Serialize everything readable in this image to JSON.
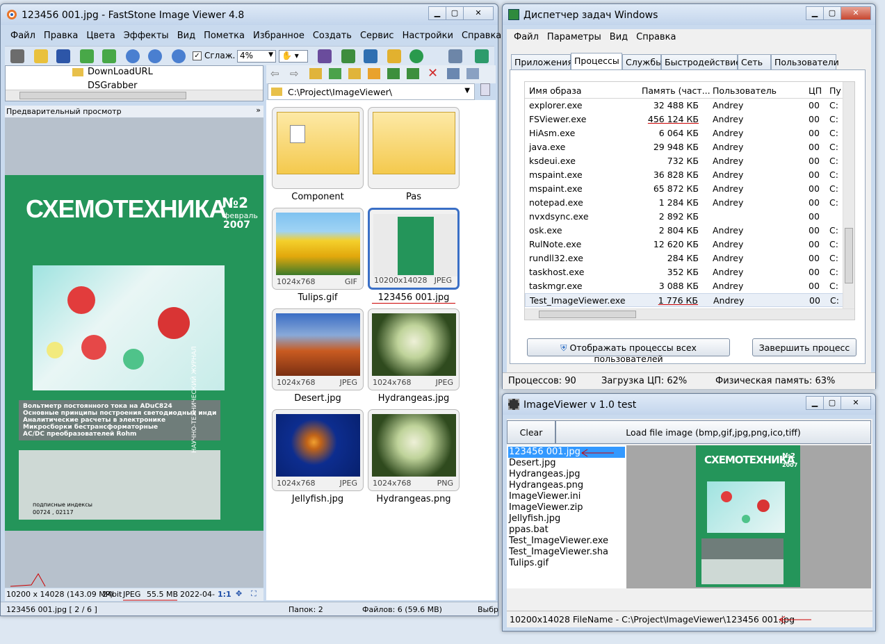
{
  "fs": {
    "title": "123456 001.jpg  -  FastStone Image Viewer 4.8",
    "menu": [
      "Файл",
      "Правка",
      "Цвета",
      "Эффекты",
      "Вид",
      "Пометка",
      "Избранное",
      "Создать",
      "Сервис",
      "Настройки",
      "Справка"
    ],
    "smooth_label": "Сглаж.",
    "zoom_value": "4%",
    "tree_items": [
      "DownLoadURL",
      "DSGrabber"
    ],
    "preview_label": "Предварительный просмотр",
    "path": "C:\\Project\\ImageViewer\\",
    "magazine": {
      "title": "СХЕМОТЕХНИКА",
      "issue": "№2",
      "month": "февраль",
      "year": "2007",
      "lines": [
        "Вольтметр постоянного тока на ADuC824",
        "Основные принципы построения светодиодных индикаторных панелей",
        "Аналитические расчеты в электронике",
        "Микросборки бестрансформаторные",
        "AC/DC преобразователей Rohm"
      ],
      "side_text": "НАУЧНО-ТЕХНИЧЕСКИЙ ЖУРНАЛ",
      "index_text": "подписные индексы",
      "index_num": "00724 , 02117"
    },
    "thumbs": [
      {
        "name": "Component",
        "kind": "folder"
      },
      {
        "name": "Pas",
        "kind": "folder"
      },
      {
        "name": "Tulips.gif",
        "dim": "1024x768",
        "fmt": "GIF"
      },
      {
        "name": "123456 001.jpg",
        "dim": "10200x14028",
        "fmt": "JPEG"
      },
      {
        "name": "Desert.jpg",
        "dim": "1024x768",
        "fmt": "JPEG"
      },
      {
        "name": "Hydrangeas.jpg",
        "dim": "1024x768",
        "fmt": "JPEG"
      },
      {
        "name": "Jellyfish.jpg",
        "dim": "1024x768",
        "fmt": "JPEG"
      },
      {
        "name": "Hydrangeas.png",
        "dim": "1024x768",
        "fmt": "PNG"
      }
    ],
    "info_bar": {
      "size": "10200 x 14028 (143.09 MP)",
      "bits": "24bit",
      "format": "JPEG",
      "filesize": "55.5 MB",
      "date": "2022-04-2",
      "ratio": "1:1"
    },
    "status": {
      "file": "123456 001.jpg [ 2 / 6 ]",
      "folders": "Папок: 2",
      "files": "Файлов: 6 (59.6 MB)",
      "sel": "Выбр"
    }
  },
  "tm": {
    "title": "Диспетчер задач Windows",
    "menu": [
      "Файл",
      "Параметры",
      "Вид",
      "Справка"
    ],
    "tabs": [
      "Приложения",
      "Процессы",
      "Службы",
      "Быстродействие",
      "Сеть",
      "Пользователи"
    ],
    "columns": [
      "Имя образа",
      "Память (част...",
      "Пользователь",
      "ЦП",
      "Пу"
    ],
    "rows": [
      [
        "explorer.exe",
        "32 488 КБ",
        "Andrey",
        "00",
        "C:"
      ],
      [
        "FSViewer.exe",
        "456 124 КБ",
        "Andrey",
        "00",
        "C:"
      ],
      [
        "HiAsm.exe",
        "6 064 КБ",
        "Andrey",
        "00",
        "C:"
      ],
      [
        "java.exe",
        "29 948 КБ",
        "Andrey",
        "00",
        "C:"
      ],
      [
        "ksdeui.exe",
        "732 КБ",
        "Andrey",
        "00",
        "C:"
      ],
      [
        "mspaint.exe",
        "36 828 КБ",
        "Andrey",
        "00",
        "C:"
      ],
      [
        "mspaint.exe",
        "65 872 КБ",
        "Andrey",
        "00",
        "C:"
      ],
      [
        "notepad.exe",
        "1 284 КБ",
        "Andrey",
        "00",
        "C:"
      ],
      [
        "nvxdsync.exe",
        "2 892 КБ",
        "",
        "00",
        ""
      ],
      [
        "osk.exe",
        "2 804 КБ",
        "Andrey",
        "00",
        "C:"
      ],
      [
        "RulNote.exe",
        "12 620 КБ",
        "Andrey",
        "00",
        "C:"
      ],
      [
        "rundll32.exe",
        "284 КБ",
        "Andrey",
        "00",
        "C:"
      ],
      [
        "taskhost.exe",
        "352 КБ",
        "Andrey",
        "00",
        "C:"
      ],
      [
        "taskmgr.exe",
        "3 088 КБ",
        "Andrey",
        "00",
        "C:"
      ],
      [
        "Test_ImageViewer.exe",
        "1 776 КБ",
        "Andrey",
        "00",
        "C:"
      ]
    ],
    "show_all_btn": "Отображать процессы всех пользователей",
    "end_btn": "Завершить процесс",
    "status": {
      "procs": "Процессов: 90",
      "cpu": "Загрузка ЦП: 62%",
      "mem": "Физическая память: 63%"
    }
  },
  "iv": {
    "title": "ImageViewer v 1.0 test",
    "clear_btn": "Clear",
    "load_btn": "Load file image (bmp,gif,jpg,png,ico,tiff)",
    "files": [
      "123456 001.jpg",
      "Desert.jpg",
      "Hydrangeas.jpg",
      "Hydrangeas.png",
      "ImageViewer.ini",
      "ImageViewer.zip",
      "Jellyfish.jpg",
      "ppas.bat",
      "Test_ImageViewer.exe",
      "Test_ImageViewer.sha",
      "Tulips.gif"
    ],
    "status": "10200x14028 FileName - C:\\Project\\ImageViewer\\123456 001.jpg"
  },
  "colors": {
    "accent": "#3399ff",
    "selection": "#3a6fc6",
    "cover_green": "#1f9a5a",
    "annotation": "#cc0000"
  }
}
